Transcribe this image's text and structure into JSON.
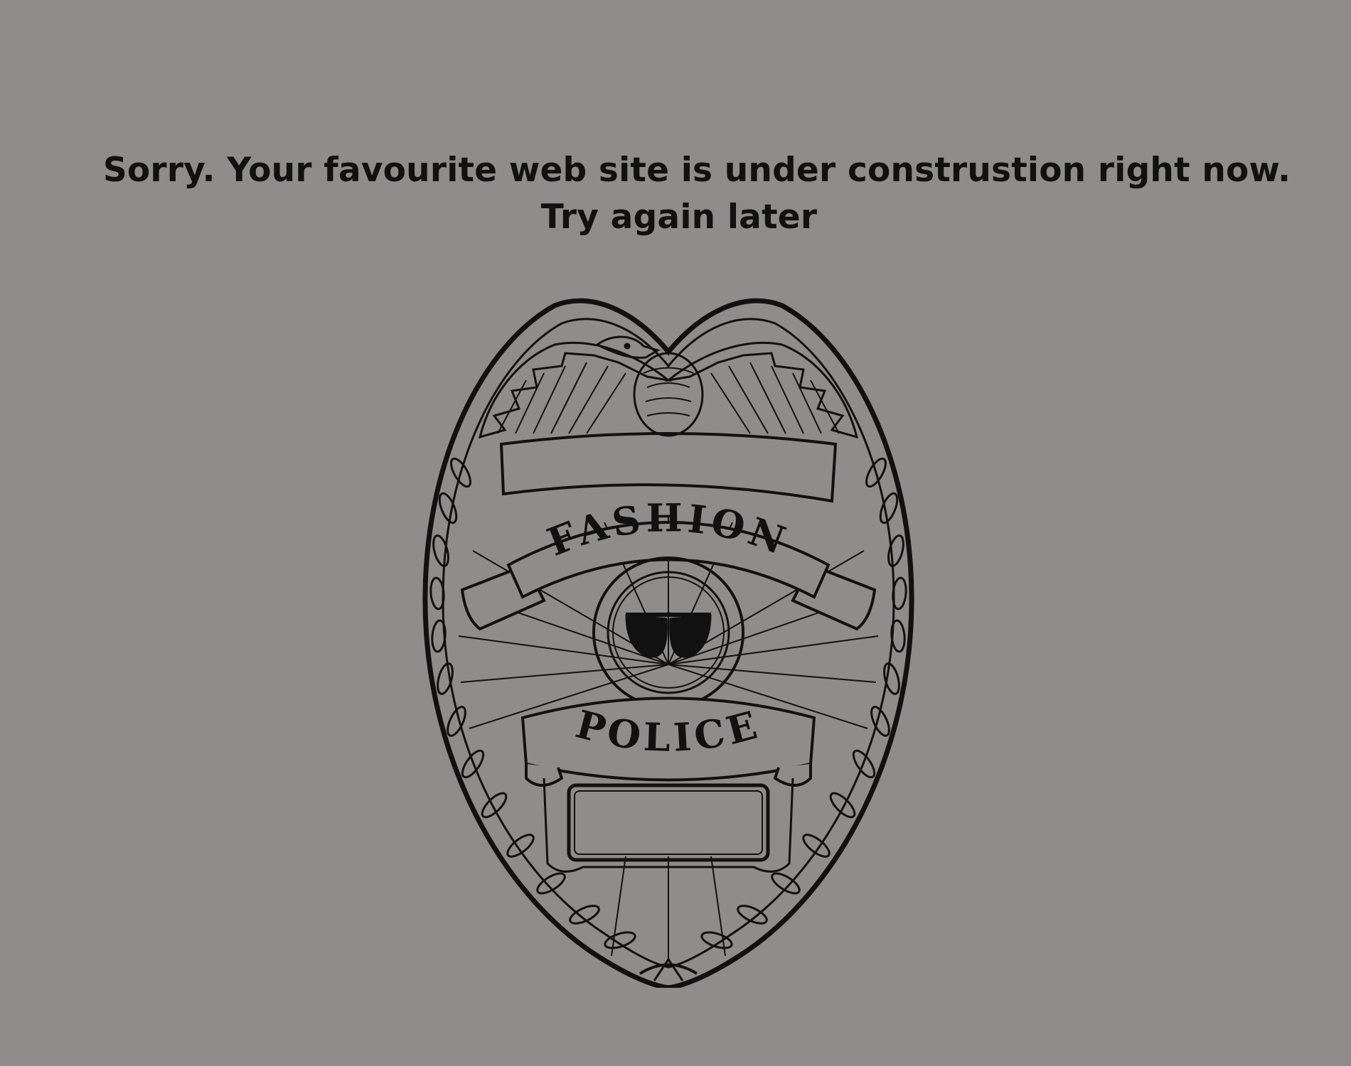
{
  "message": {
    "line1": "Sorry. Your favourite web site is under construstion right now.",
    "line2": "Try again later"
  },
  "badge": {
    "top_text": "FASHION",
    "bottom_text": "POLICE",
    "center_icon": "sunglasses-icon"
  },
  "colors": {
    "background": "#908c8c",
    "ink": "#111111"
  }
}
